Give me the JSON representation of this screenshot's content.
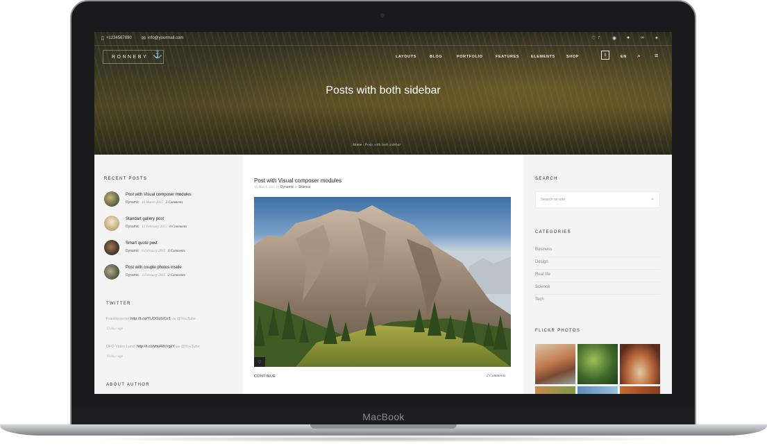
{
  "device": {
    "brand": "MacBook"
  },
  "topbar": {
    "phone": "+1234567890",
    "email": "info@yourmail.com",
    "likes_count": "7"
  },
  "header": {
    "logo": "RONNEBY",
    "menu": [
      "LAYOUTS",
      "BLOG",
      "PORTFOLIO",
      "FEATURES",
      "ELEMENTS",
      "SHOP"
    ],
    "cart_count": "0",
    "language": "EN"
  },
  "hero": {
    "title": "Posts with both sidebar",
    "breadcrumb_home": "Home",
    "breadcrumb_sep": "›",
    "breadcrumb_current": "Posts with both sidebar"
  },
  "left_sidebar": {
    "recent_title": "RECENT POSTS",
    "recent_posts": [
      {
        "title": "Post with Visual composer modules",
        "author": "Dynamic",
        "date": "16 March 2015",
        "comments": "2 Comments"
      },
      {
        "title": "Standart gallery post",
        "author": "Dynamic",
        "date": "13 February 2015",
        "comments": "0 Comments"
      },
      {
        "title": "Smart quote post",
        "author": "Dynamic",
        "date": "6 February 2015",
        "comments": "0 Comments"
      },
      {
        "title": "Post with couple photos inside",
        "author": "Dynamic",
        "date": "3 February 2015",
        "comments": "2 Comments"
      }
    ],
    "twitter_title": "TWITTER",
    "tweets": [
      {
        "user": "Frankiecenter",
        "link": "http://t.co/YUOGc6rDz1",
        "via": "via",
        "source": "@YouTube",
        "date": "12 days ago"
      },
      {
        "user": "DFO Video Land:",
        "link": "http://t.co/vhu42sVgkY",
        "via": "via",
        "source": "@YouTube",
        "date": "16 days ago"
      }
    ],
    "about_title": "ABOUT AUTHOR"
  },
  "post": {
    "title": "Post with Visual composer modules",
    "date": "16 March 2015",
    "by": "by",
    "author": "Dynamic",
    "in": "in",
    "category": "Science",
    "continue_label": "CONTINUE",
    "comments": "2   Comments"
  },
  "right_sidebar": {
    "search_title": "SEARCH",
    "search_placeholder": "Search on site",
    "categories_title": "CATEGORIES",
    "categories": [
      "Business",
      "Design",
      "Real life",
      "Science",
      "Tech"
    ],
    "flickr_title": "FLICKR PHOTOS"
  }
}
